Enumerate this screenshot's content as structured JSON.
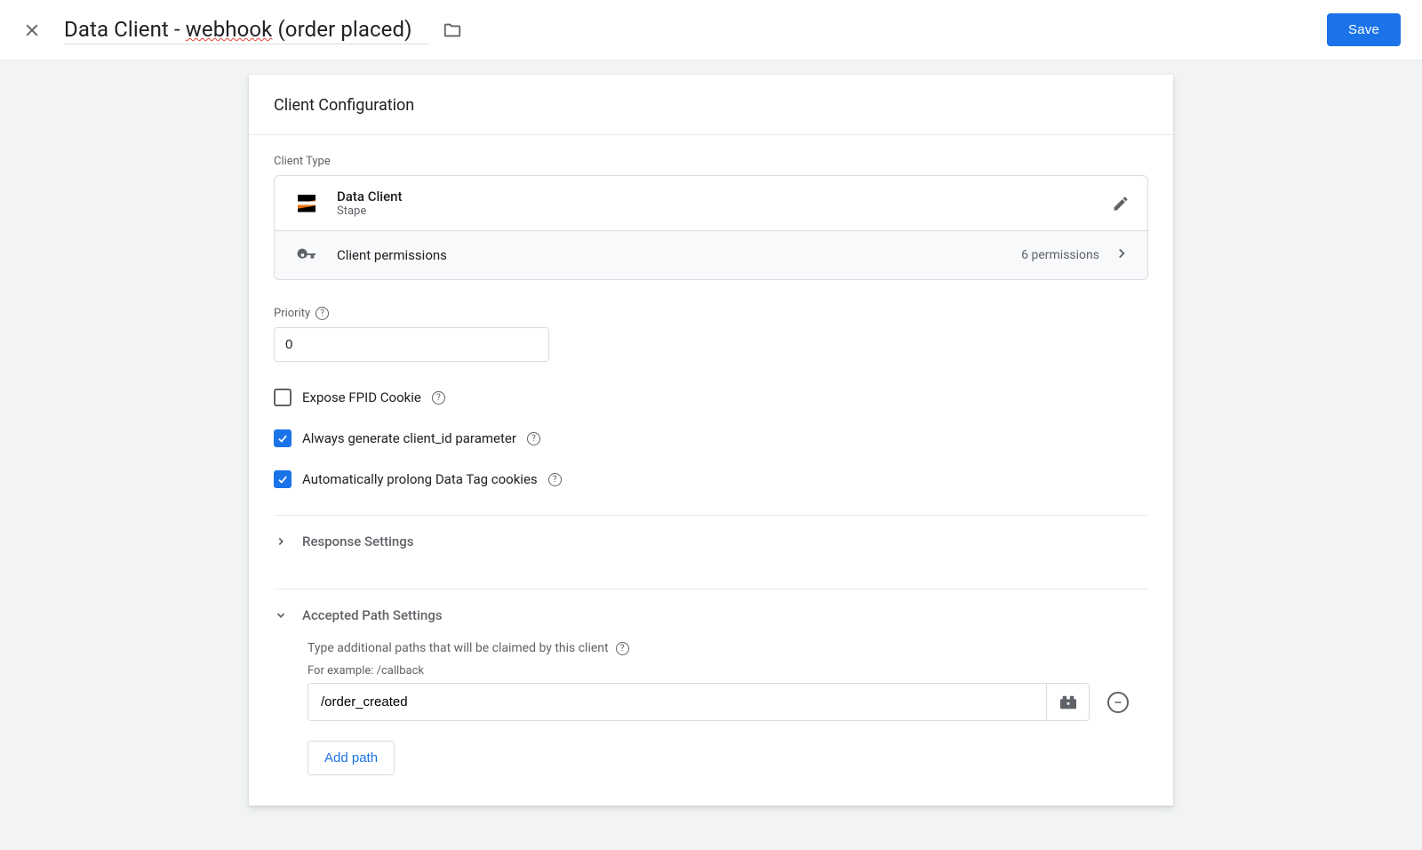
{
  "header": {
    "title_prefix": "Data Client - ",
    "title_underlined": "webhook",
    "title_suffix": " (order placed)",
    "save_label": "Save"
  },
  "panel": {
    "title": "Client Configuration",
    "client_type_label": "Client Type",
    "client_name": "Data Client",
    "client_vendor": "Stape",
    "permissions_label": "Client permissions",
    "permissions_count": "6 permissions",
    "priority_label": "Priority",
    "priority_value": "0",
    "checkboxes": {
      "fpid": {
        "label": "Expose FPID Cookie",
        "checked": false
      },
      "client_id": {
        "label": "Always generate client_id parameter",
        "checked": true
      },
      "prolong": {
        "label": "Automatically prolong Data Tag cookies",
        "checked": true
      }
    },
    "response_settings_title": "Response Settings",
    "paths": {
      "title": "Accepted Path Settings",
      "hint": "Type additional paths that will be claimed by this client",
      "example": "For example: /callback",
      "value": "/order_created",
      "add_label": "Add path"
    }
  }
}
